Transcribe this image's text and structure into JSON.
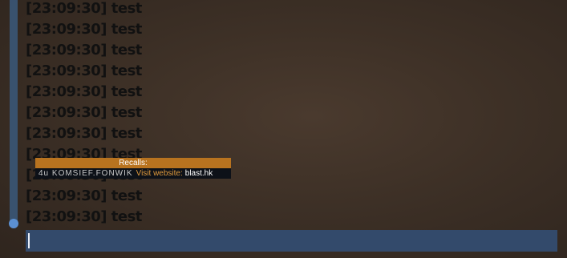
{
  "chat": {
    "lines": [
      "[23:09:30] test",
      "[23:09:30] test",
      "[23:09:30] test",
      "[23:09:30] test",
      "[23:09:30] test",
      "[23:09:30] test",
      "[23:09:30] test",
      "[23:09:30] test",
      "[23:09:30] test",
      "[23:09:30] test",
      "[23:09:30] test"
    ],
    "input_value": ""
  },
  "recalls": {
    "header": "Recalls:",
    "name_text": "4u KOMSIEF.FONWIK",
    "visit_label": "Visit website:",
    "url": "blast.hk"
  },
  "colors": {
    "scrollbar": "#3a5677",
    "input_bar": "#334a6b",
    "popup_header": "#b8731f",
    "popup_body": "#0d1118",
    "accent_text": "#e09a3c"
  }
}
